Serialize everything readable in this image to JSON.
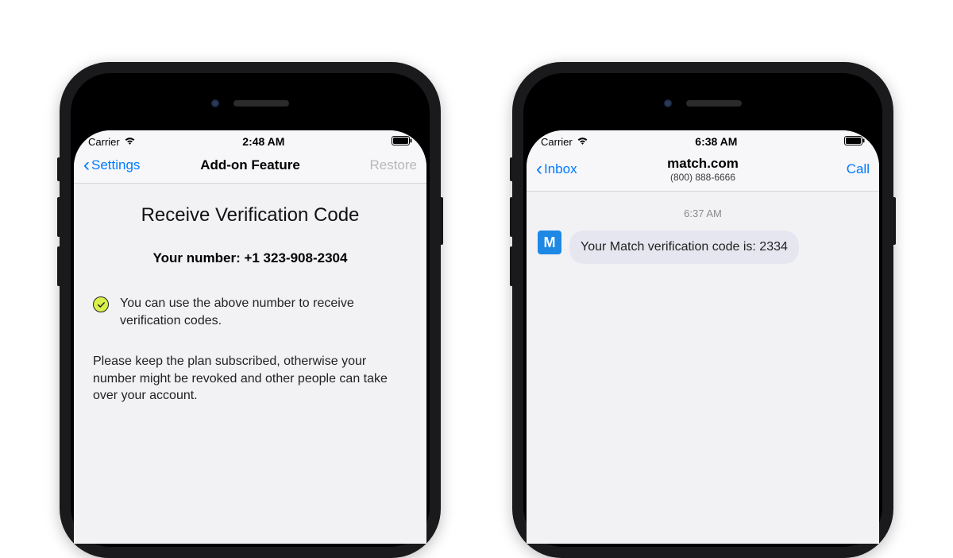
{
  "left": {
    "status": {
      "carrier": "Carrier",
      "time": "2:48 AM"
    },
    "nav": {
      "back": "Settings",
      "title": "Add-on Feature",
      "right": "Restore"
    },
    "heading": "Receive Verification Code",
    "number_label": "Your number: +1 323-908-2304",
    "info": "You can use the above number to receive verification codes.",
    "warning": "Please keep the plan subscribed, otherwise your number might be revoked and other people can take over your account."
  },
  "right": {
    "status": {
      "carrier": "Carrier",
      "time": "6:38 AM"
    },
    "nav": {
      "back": "Inbox",
      "title": "match.com",
      "subtitle": "(800) 888-6666",
      "right": "Call"
    },
    "msg_time": "6:37 AM",
    "avatar_letter": "M",
    "message": "Your Match verification code is: 2334"
  }
}
